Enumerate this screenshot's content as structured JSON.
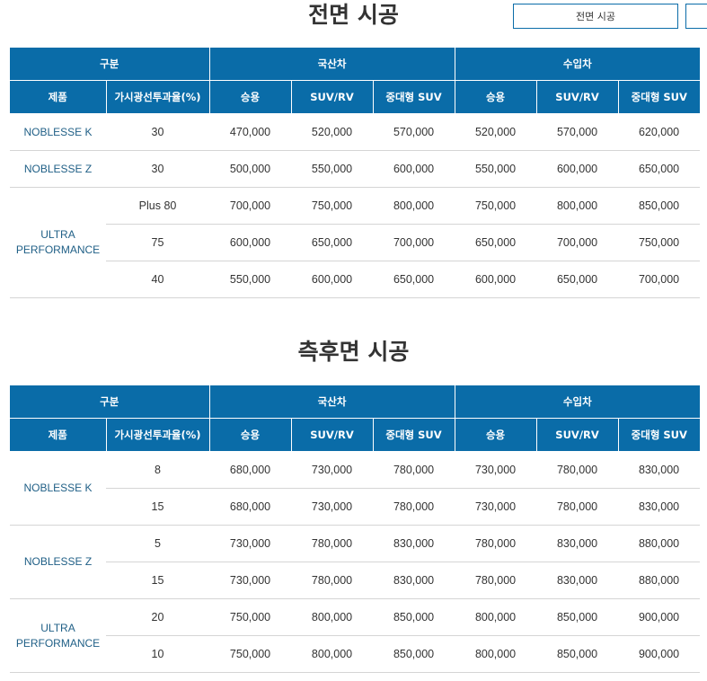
{
  "section1": {
    "title": "전면 시공"
  },
  "section2": {
    "title": "측후면 시공"
  },
  "buttons": {
    "front": "전면 시공"
  },
  "header": {
    "group": "구분",
    "domestic": "국산차",
    "imported": "수입차",
    "product": "제품",
    "vlt": "가시광선투과율(%)",
    "sedan": "승용",
    "suvrv": "SUV/RV",
    "large_suv": "중대형 SUV"
  },
  "table1": {
    "rows": [
      {
        "product": "NOBLESSE K",
        "vlt": "30",
        "prices": [
          "470,000",
          "520,000",
          "570,000",
          "520,000",
          "570,000",
          "620,000"
        ]
      },
      {
        "product": "NOBLESSE Z",
        "vlt": "30",
        "prices": [
          "500,000",
          "550,000",
          "600,000",
          "550,000",
          "600,000",
          "650,000"
        ]
      },
      {
        "product": "ULTRA\nPERFORMANCE",
        "vlt": "Plus 80",
        "prices": [
          "700,000",
          "750,000",
          "800,000",
          "750,000",
          "800,000",
          "850,000"
        ]
      },
      {
        "product": "",
        "vlt": "75",
        "prices": [
          "600,000",
          "650,000",
          "700,000",
          "650,000",
          "700,000",
          "750,000"
        ]
      },
      {
        "product": "",
        "vlt": "40",
        "prices": [
          "550,000",
          "600,000",
          "650,000",
          "600,000",
          "650,000",
          "700,000"
        ]
      }
    ]
  },
  "table2": {
    "rows": [
      {
        "product": "NOBLESSE K",
        "vlt": "8",
        "prices": [
          "680,000",
          "730,000",
          "780,000",
          "730,000",
          "780,000",
          "830,000"
        ]
      },
      {
        "product": "",
        "vlt": "15",
        "prices": [
          "680,000",
          "730,000",
          "780,000",
          "730,000",
          "780,000",
          "830,000"
        ]
      },
      {
        "product": "NOBLESSE Z",
        "vlt": "5",
        "prices": [
          "730,000",
          "780,000",
          "830,000",
          "780,000",
          "830,000",
          "880,000"
        ]
      },
      {
        "product": "",
        "vlt": "15",
        "prices": [
          "730,000",
          "780,000",
          "830,000",
          "780,000",
          "830,000",
          "880,000"
        ]
      },
      {
        "product": "ULTRA\nPERFORMANCE",
        "vlt": "20",
        "prices": [
          "750,000",
          "800,000",
          "850,000",
          "800,000",
          "850,000",
          "900,000"
        ]
      },
      {
        "product": "",
        "vlt": "10",
        "prices": [
          "750,000",
          "800,000",
          "850,000",
          "800,000",
          "850,000",
          "900,000"
        ]
      }
    ]
  }
}
